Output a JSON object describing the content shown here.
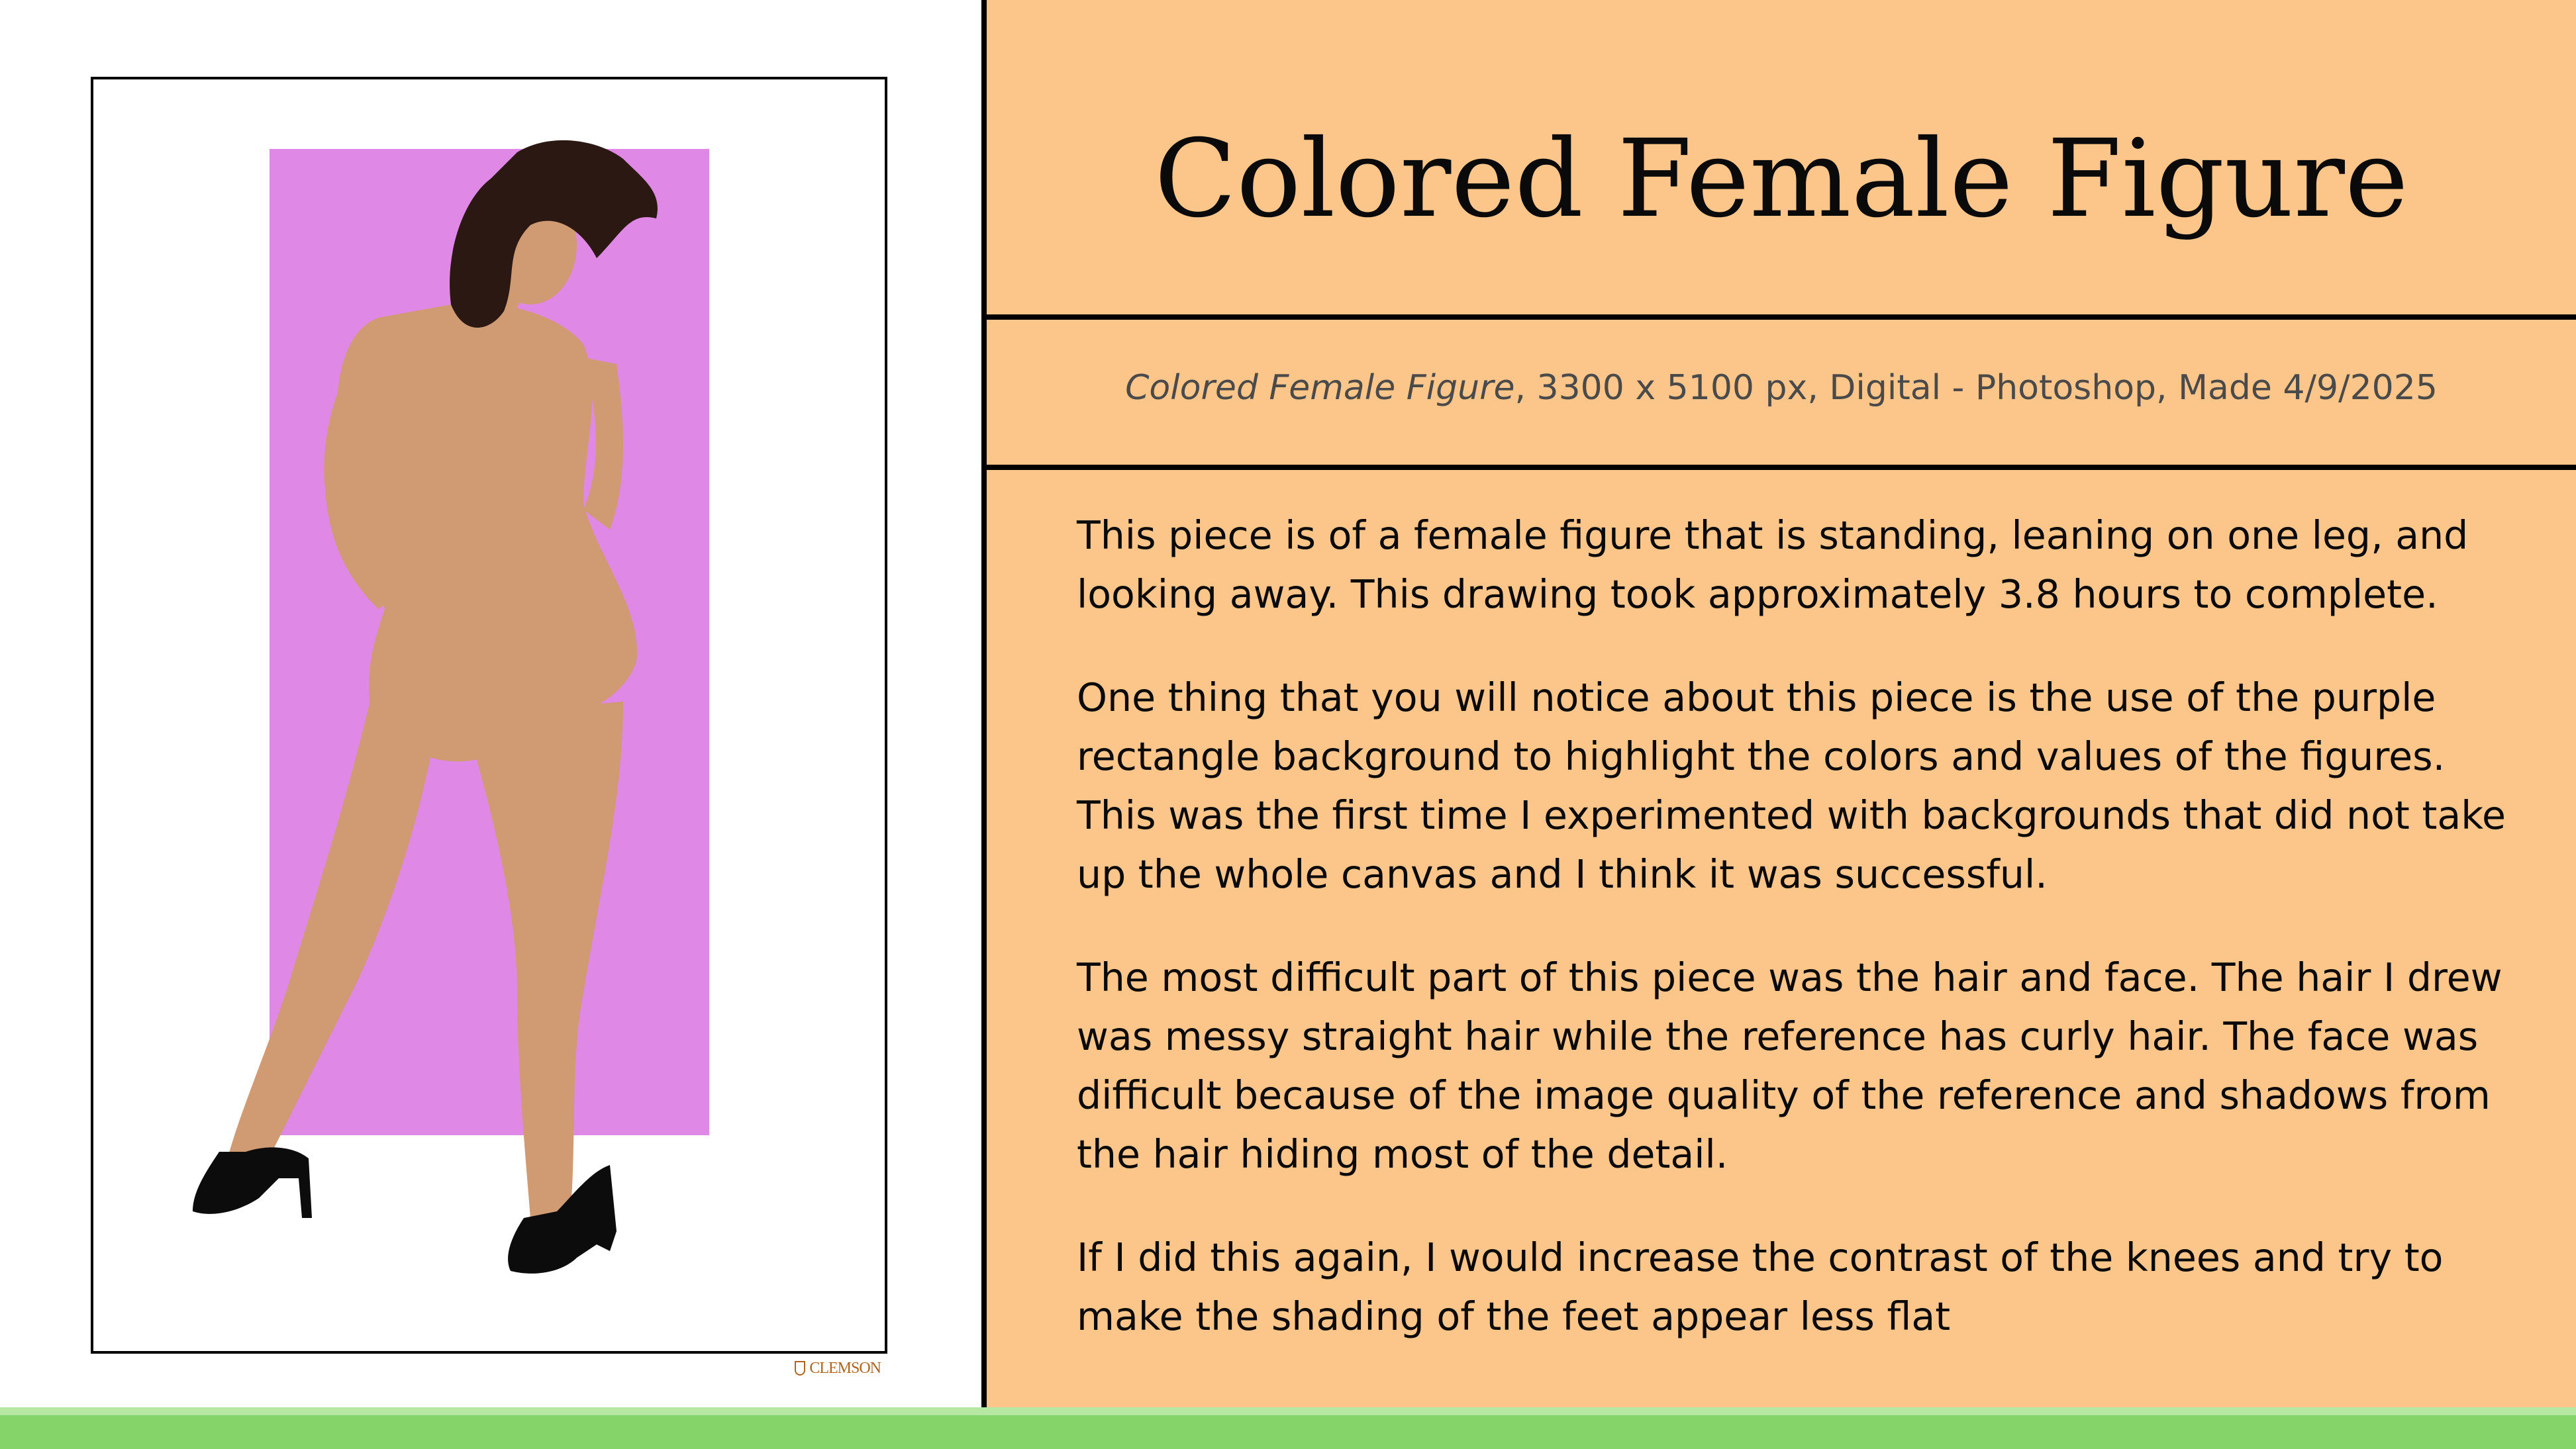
{
  "slide": {
    "title": "Colored Female Figure",
    "caption": {
      "artwork_title": "Colored Female Figure",
      "details": ", 3300 x 5100 px, Digital - Photoshop, Made 4/9/2025"
    },
    "paragraphs": [
      "This piece is of a female figure that is standing, leaning on one leg, and looking away. This drawing took approximately 3.8 hours to complete.",
      "One thing that you will notice about this piece is the use of the purple rectangle background to highlight the colors and values of the figures. This was the first time I experimented with backgrounds that did not take up the whole canvas and I think it was successful.",
      "The most difficult part of this piece was the hair and face. The hair I drew was messy straight hair while the reference has curly hair. The face was difficult because of the image quality of the reference and shadows from the hair hiding most of the detail.",
      "If I did this again, I would increase the contrast of the knees and try to make the shading of the feet appear less flat"
    ]
  },
  "artwork": {
    "background_rect_color": "#e088e6",
    "skin_color": "#d09a72",
    "hair_color": "#2c1812",
    "shoe_color": "#0c0c0c"
  },
  "logo": {
    "text": "CLEMSON"
  },
  "colors": {
    "panel_background": "#fcc68b",
    "footer_bar": "#84d46a",
    "rules": "#000000"
  }
}
